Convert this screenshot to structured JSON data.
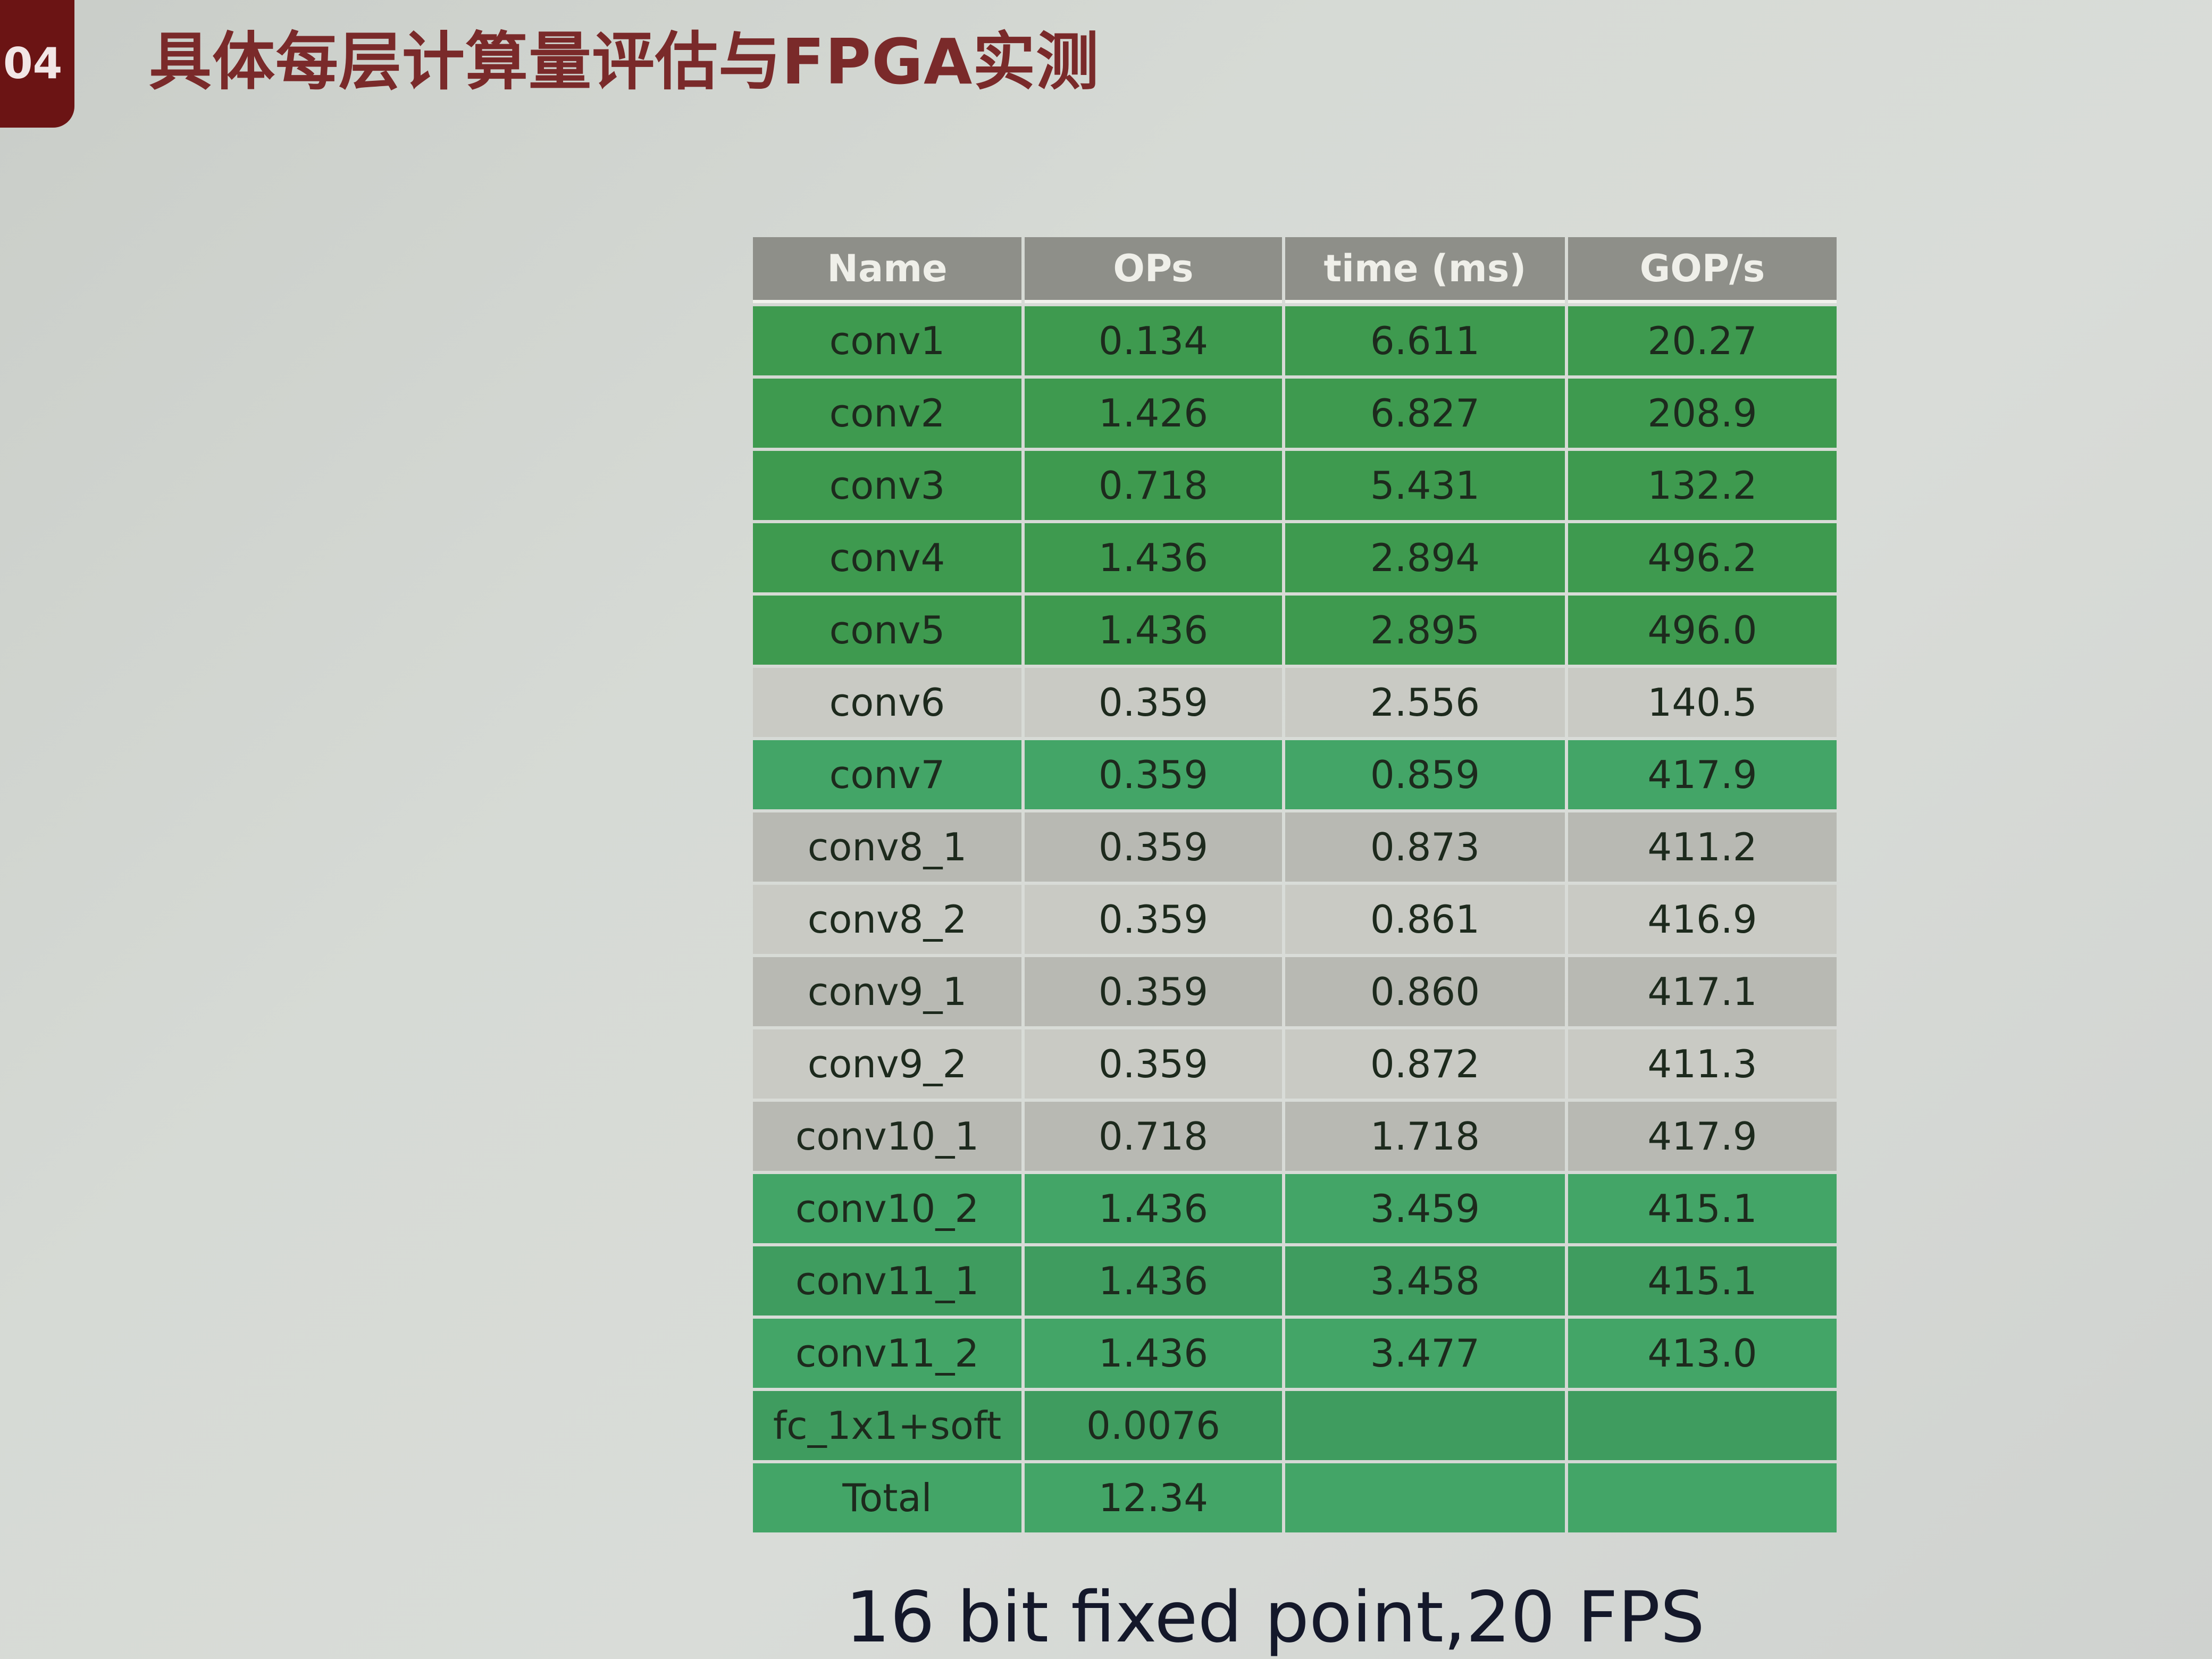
{
  "slide": {
    "badge": "04",
    "title": "具体每层计算量评估与FPGA实测"
  },
  "table": {
    "headers": [
      "Name",
      "OPs",
      "time (ms)",
      "GOP/s"
    ],
    "rows": [
      {
        "name": "conv1",
        "ops": "0.134",
        "time": "6.611",
        "gops": "20.27",
        "style": "dark"
      },
      {
        "name": "conv2",
        "ops": "1.426",
        "time": "6.827",
        "gops": "208.9",
        "style": "dark"
      },
      {
        "name": "conv3",
        "ops": "0.718",
        "time": "5.431",
        "gops": "132.2",
        "style": "dark"
      },
      {
        "name": "conv4",
        "ops": "1.436",
        "time": "2.894",
        "gops": "496.2",
        "style": "dark"
      },
      {
        "name": "conv5",
        "ops": "1.436",
        "time": "2.895",
        "gops": "496.0",
        "style": "dark"
      },
      {
        "name": "conv6",
        "ops": "0.359",
        "time": "2.556",
        "gops": "140.5",
        "style": "gray-b"
      },
      {
        "name": "conv7",
        "ops": "0.359",
        "time": "0.859",
        "gops": "417.9",
        "style": "mint"
      },
      {
        "name": "conv8_1",
        "ops": "0.359",
        "time": "0.873",
        "gops": "411.2",
        "style": "gray-a"
      },
      {
        "name": "conv8_2",
        "ops": "0.359",
        "time": "0.861",
        "gops": "416.9",
        "style": "gray-b"
      },
      {
        "name": "conv9_1",
        "ops": "0.359",
        "time": "0.860",
        "gops": "417.1",
        "style": "gray-a"
      },
      {
        "name": "conv9_2",
        "ops": "0.359",
        "time": "0.872",
        "gops": "411.3",
        "style": "gray-b"
      },
      {
        "name": "conv10_1",
        "ops": "0.718",
        "time": "1.718",
        "gops": "417.9",
        "style": "gray-a"
      },
      {
        "name": "conv10_2",
        "ops": "1.436",
        "time": "3.459",
        "gops": "415.1",
        "style": "mint"
      },
      {
        "name": "conv11_1",
        "ops": "1.436",
        "time": "3.458",
        "gops": "415.1",
        "style": "mint-alt"
      },
      {
        "name": "conv11_2",
        "ops": "1.436",
        "time": "3.477",
        "gops": "413.0",
        "style": "mint"
      },
      {
        "name": "fc_1x1+soft",
        "ops": "0.0076",
        "time": "",
        "gops": "",
        "style": "mint-alt"
      },
      {
        "name": "Total",
        "ops": "12.34",
        "time": "",
        "gops": "",
        "style": "mint"
      }
    ]
  },
  "caption": "16 bit fixed point,20 FPS"
}
